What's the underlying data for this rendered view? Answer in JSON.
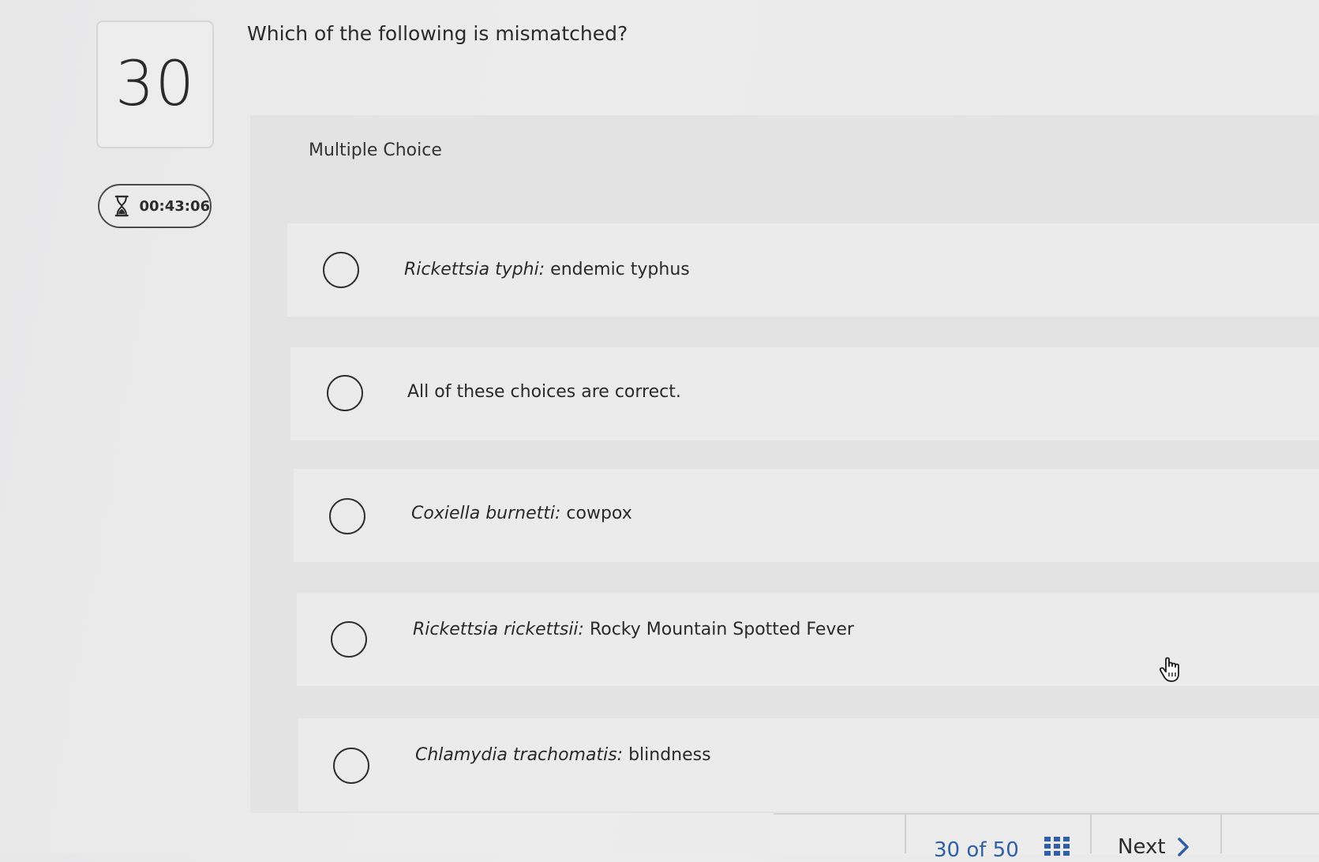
{
  "question_number": "30",
  "timer": {
    "value": "00:43:06",
    "icon": "hourglass-icon"
  },
  "question_text": "Which of the following is mismatched?",
  "question_type": "Multiple Choice",
  "options": [
    {
      "term": "Rickettsia typhi:",
      "answer": "endemic typhus",
      "selected": false
    },
    {
      "term": "",
      "answer": "All of these choices are correct.",
      "selected": false
    },
    {
      "term": "Coxiella burnetti:",
      "answer": "cowpox",
      "selected": false
    },
    {
      "term": "Rickettsia rickettsii:",
      "answer": "Rocky Mountain Spotted Fever",
      "selected": false
    },
    {
      "term": "Chlamydia trachomatis:",
      "answer": "blindness",
      "selected": false
    }
  ],
  "footer": {
    "progress": "30 of 50",
    "grid_icon": "grid-icon",
    "next_label": "Next",
    "next_icon": "chevron-right-icon"
  },
  "colors": {
    "accent": "#2f5fa8"
  }
}
